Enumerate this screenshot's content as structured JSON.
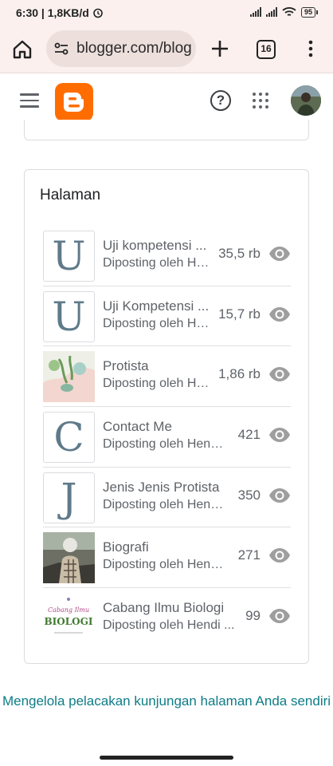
{
  "status_bar": {
    "time": "6:30",
    "network_speed": "1,8KB/d",
    "battery": "95",
    "icons": [
      "alarm-icon",
      "signal-icon",
      "signal-icon",
      "wifi-icon",
      "battery-icon"
    ]
  },
  "browser": {
    "url": "blogger.com/blog",
    "tab_count": "16",
    "icons": [
      "home-icon",
      "site-settings-icon",
      "new-tab-icon",
      "tab-switcher-icon",
      "overflow-menu-icon"
    ]
  },
  "app_bar": {
    "icons": [
      "hamburger-menu-icon",
      "blogger-logo",
      "help-icon",
      "apps-grid-icon",
      "avatar"
    ]
  },
  "pages_card": {
    "title": "Halaman",
    "items": [
      {
        "thumb_letter": "U",
        "title": "Uji kompetensi ...",
        "author": "Diposting oleh Hendi ...",
        "views": "35,5 rb"
      },
      {
        "thumb_letter": "U",
        "title": "Uji Kompetensi ...",
        "author": "Diposting oleh Hendi ...",
        "views": "15,7 rb"
      },
      {
        "thumb_letter": "",
        "title": "Protista",
        "author": "Diposting oleh Hendi ...",
        "views": "1,86 rb"
      },
      {
        "thumb_letter": "C",
        "title": "Contact Me",
        "author": "Diposting oleh Hendi ...",
        "views": "421"
      },
      {
        "thumb_letter": "J",
        "title": "Jenis Jenis Protista",
        "author": "Diposting oleh Hendi ...",
        "views": "350"
      },
      {
        "thumb_letter": "",
        "title": "Biografi",
        "author": "Diposting oleh Hendi ...",
        "views": "271"
      },
      {
        "thumb_letter": "",
        "title": "Cabang Ilmu Biologi",
        "author": "Diposting oleh Hendi ...",
        "views": "99",
        "thumb_text_line1": "Cabang Ilmu",
        "thumb_text_line2": "BIOLOGI"
      }
    ]
  },
  "footer_link": "Mengelola pelacakan kunjungan halaman Anda sendiri",
  "colors": {
    "blogger_orange": "#ff6d00",
    "link_teal": "#0e7c86",
    "browser_bar": "#fbf0ee"
  }
}
